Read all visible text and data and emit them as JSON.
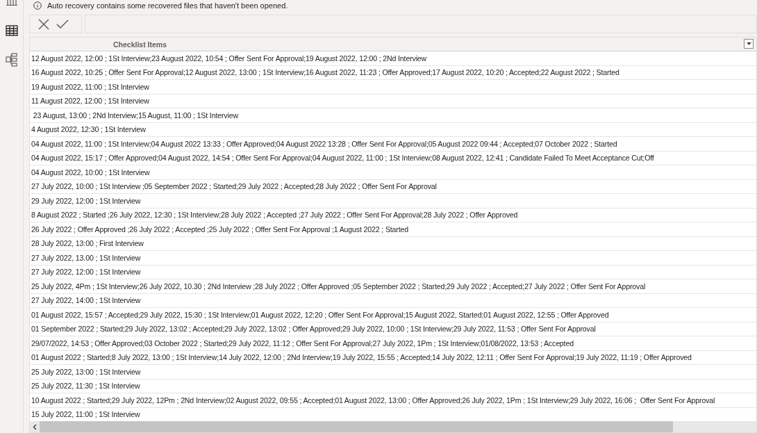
{
  "banner": {
    "message": "Auto recovery contains some recovered files that haven't been opened."
  },
  "table": {
    "columns": [
      "Checklist Items"
    ],
    "rows": [
      "12 August 2022, 12:00 ; 1St Interview;23 August 2022, 10:54 ; Offer Sent For Approval;19 August 2022, 12:00 ; 2Nd Interview",
      "16 August 2022, 10:25 ; Offer Sent For Approval;12 August 2022, 13:00 ; 1St Interview;16 August 2022, 11:23 ; Offer Approved;17 August 2022, 10:20 ; Accepted;22 August 2022 ; Started",
      "19 August 2022, 11:00 ; 1St Interview",
      "11 August 2022, 12:00 ; 1St Interview",
      " 23 August, 13:00 ; 2Nd Interview;15 August, 11:00 ; 1St Interview",
      "4 August 2022, 12:30 ; 1St Interview",
      "04 August 2022, 11:00 ; 1St Interview;04 August 2022 13:33 ; Offer Approved;04 August 2022 13:28 ; Offer Sent For Approval;05 August 2022 09:44 ; Accepted;07 October 2022 ; Started",
      "04 August 2022, 15:17 ; Offer Approved;04 August 2022, 14:54 ; Offer Sent For Approval;04 August 2022, 11:00 ; 1St Interview;08 August 2022, 12:41 ; Candidate Failed To Meet Acceptance Cut;Off",
      "04 August 2022, 10:00 ; 1St Interview",
      "27 July 2022, 10:00 ; 1St Interview ;05 September 2022 ; Started;29 July 2022 ; Accepted;28 July 2022 ; Offer Sent For Approval",
      "29 July 2022, 12:00 ; 1St Interview",
      "8 August 2022 ; Started ;26 July 2022, 12:30 ; 1St Interview;28 July 2022 ; Accepted ;27 July 2022 ; Offer Sent For Approval;28 July 2022 ; Offer Approved",
      "26 July 2022 ; Offer Approved ;26 July 2022 ; Accepted ;25 July 2022 ; Offer Sent For Approval ;1 August 2022 ; Started",
      "28 July 2022, 13:00 ; First Interview",
      "27 July 2022, 13.00 ; 1St Interview",
      "27 July 2022, 12:00 ; 1St Interview",
      "25 July 2022, 4Pm ; 1St Interview;26 July 2022, 10.30 ; 2Nd Interview ;28 July 2022 ; Offer Approved ;05 September 2022 ; Started;29 July 2022 ; Accepted;27 July 2022 ; Offer Sent For Approval",
      "27 July 2022, 14:00 ; 1St Interview",
      "01 August 2022, 15:57 ; Accepted;29 July 2022, 15:30 ; 1St Interview;01 August 2022, 12:20 ; Offer Sent For Approval;15 August 2022, Started;01 August 2022, 12:55 ; Offer Approved",
      "01 September 2022 ; Started;29 July 2022, 13:02 ; Accepted;29 July 2022, 13:02 ; Offer Approved;29 July 2022, 10:00 ; 1St Interview;29 July 2022, 11:53 ; Offer Sent For Approval",
      "29/07/2022, 14:53 ; Offer Approved;03 October 2022 ; Started;29 July 2022, 11:12 ; Offer Sent For Approval;27 July 2022, 1Pm ; 1St Interview;01/08/2022, 13:53 ; Accepted",
      "01 August 2022 ; Started;8 July 2022, 13:00 ; 1St Interview;14 July 2022, 12:00 ; 2Nd Interview;19 July 2022, 15:55 ; Accepted;14 July 2022, 12:11 ; Offer Sent For Approval;19 July 2022, 11:19 ; Offer Approved",
      "25 July 2022, 13:00 ; 1St Interview",
      "25 July 2022, 11:30 ; 1St Interview",
      "10 August 2022 ; Started;29 July 2022, 12Pm ; 2Nd Interview;02 August 2022, 09:55 ; Accepted;01 August 2022, 13:00 ; Offer Approved;26 July 2022, 1Pm ; 1St Interview;29 July 2022, 16:06 ;  Offer Sent For Approval",
      "15 July 2022, 11:00 ; 1St Interview"
    ]
  }
}
